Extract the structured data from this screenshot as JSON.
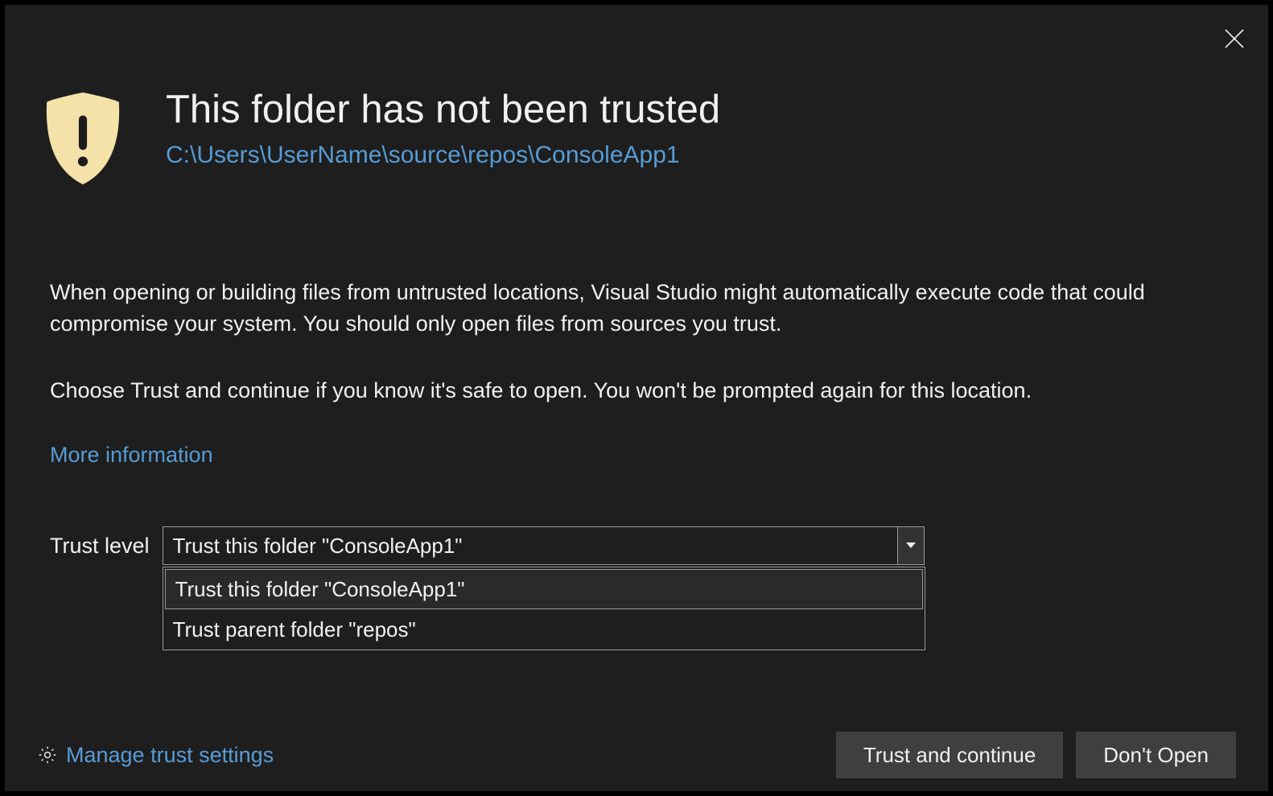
{
  "title": "This folder has not been trusted",
  "path": "C:\\Users\\UserName\\source\\repos\\ConsoleApp1",
  "body": {
    "p1": "When opening or building files from untrusted locations, Visual Studio might automatically execute code that could compromise your system. You should only open files from sources you trust.",
    "p2": "Choose Trust and continue if you know it's safe to open. You won't be prompted again for this location."
  },
  "moreInfo": "More information",
  "trustLevel": {
    "label": "Trust level",
    "selected": "Trust this folder \"ConsoleApp1\"",
    "options": [
      "Trust this folder \"ConsoleApp1\"",
      "Trust parent folder \"repos\""
    ]
  },
  "manageLink": "Manage trust settings",
  "buttons": {
    "trust": "Trust and continue",
    "dontOpen": "Don't Open"
  }
}
